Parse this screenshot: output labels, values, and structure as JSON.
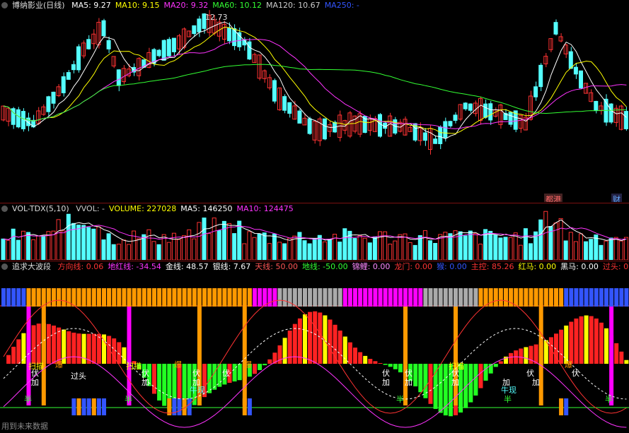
{
  "price_panel": {
    "title": "博纳影业(日线)",
    "ma": [
      {
        "label": "MA5: 9.27",
        "color": "#ffffff"
      },
      {
        "label": "MA10: 9.15",
        "color": "#ffff00"
      },
      {
        "label": "MA20: 9.32",
        "color": "#ff33ff"
      },
      {
        "label": "MA60: 10.12",
        "color": "#33ff33"
      },
      {
        "label": "MA120: 10.67",
        "color": "#cccccc"
      },
      {
        "label": "MA250: -",
        "color": "#3355ff"
      }
    ],
    "high_label": "12.73",
    "tags": [
      {
        "text": "都港",
        "color": "#ff5555"
      },
      {
        "text": "财",
        "color": "#5599ff"
      }
    ]
  },
  "volume_panel": {
    "title": "VOL-TDX(5,10)",
    "items": [
      {
        "label": "VVOL: -",
        "color": "#cccccc"
      },
      {
        "label": "VOLUME: 227028",
        "color": "#ffff00"
      },
      {
        "label": "MA5: 146250",
        "color": "#ffffff"
      },
      {
        "label": "MA10: 124475",
        "color": "#ff33ff"
      }
    ]
  },
  "indicator_panel": {
    "title": "追求大波段",
    "items": [
      {
        "label": "方向线: 0.06",
        "color": "#ff3333"
      },
      {
        "label": "地红线: -34.54",
        "color": "#ff33ff"
      },
      {
        "label": "金线: 48.57",
        "color": "#ffffff"
      },
      {
        "label": "银线: 7.67",
        "color": "#ffffff"
      },
      {
        "label": "天线: 50.00",
        "color": "#ff5555"
      },
      {
        "label": "地线: -50.00",
        "color": "#33ff33"
      },
      {
        "label": "锦鲤: 0.00",
        "color": "#ff88ff"
      },
      {
        "label": "龙门: 0.00",
        "color": "#ff3333"
      },
      {
        "label": "猴: 0.00",
        "color": "#3355ff"
      },
      {
        "label": "主控: 85.26",
        "color": "#ff3333"
      },
      {
        "label": "红马: 0.00",
        "color": "#ffff00"
      },
      {
        "label": "黑马: 0.00",
        "color": "#ffffff"
      },
      {
        "label": "过头: 0",
        "color": "#ff3333"
      }
    ],
    "annotations": {
      "scan": "扫描",
      "fu": "伏",
      "jia": "加",
      "guotou": "过头",
      "bao": "爆",
      "niuxian": "牛现",
      "ban": "半"
    }
  },
  "footer": "用到未来数据",
  "colors": {
    "up": "#ff3333",
    "down": "#54ffff",
    "frame": "#7a1010"
  }
}
